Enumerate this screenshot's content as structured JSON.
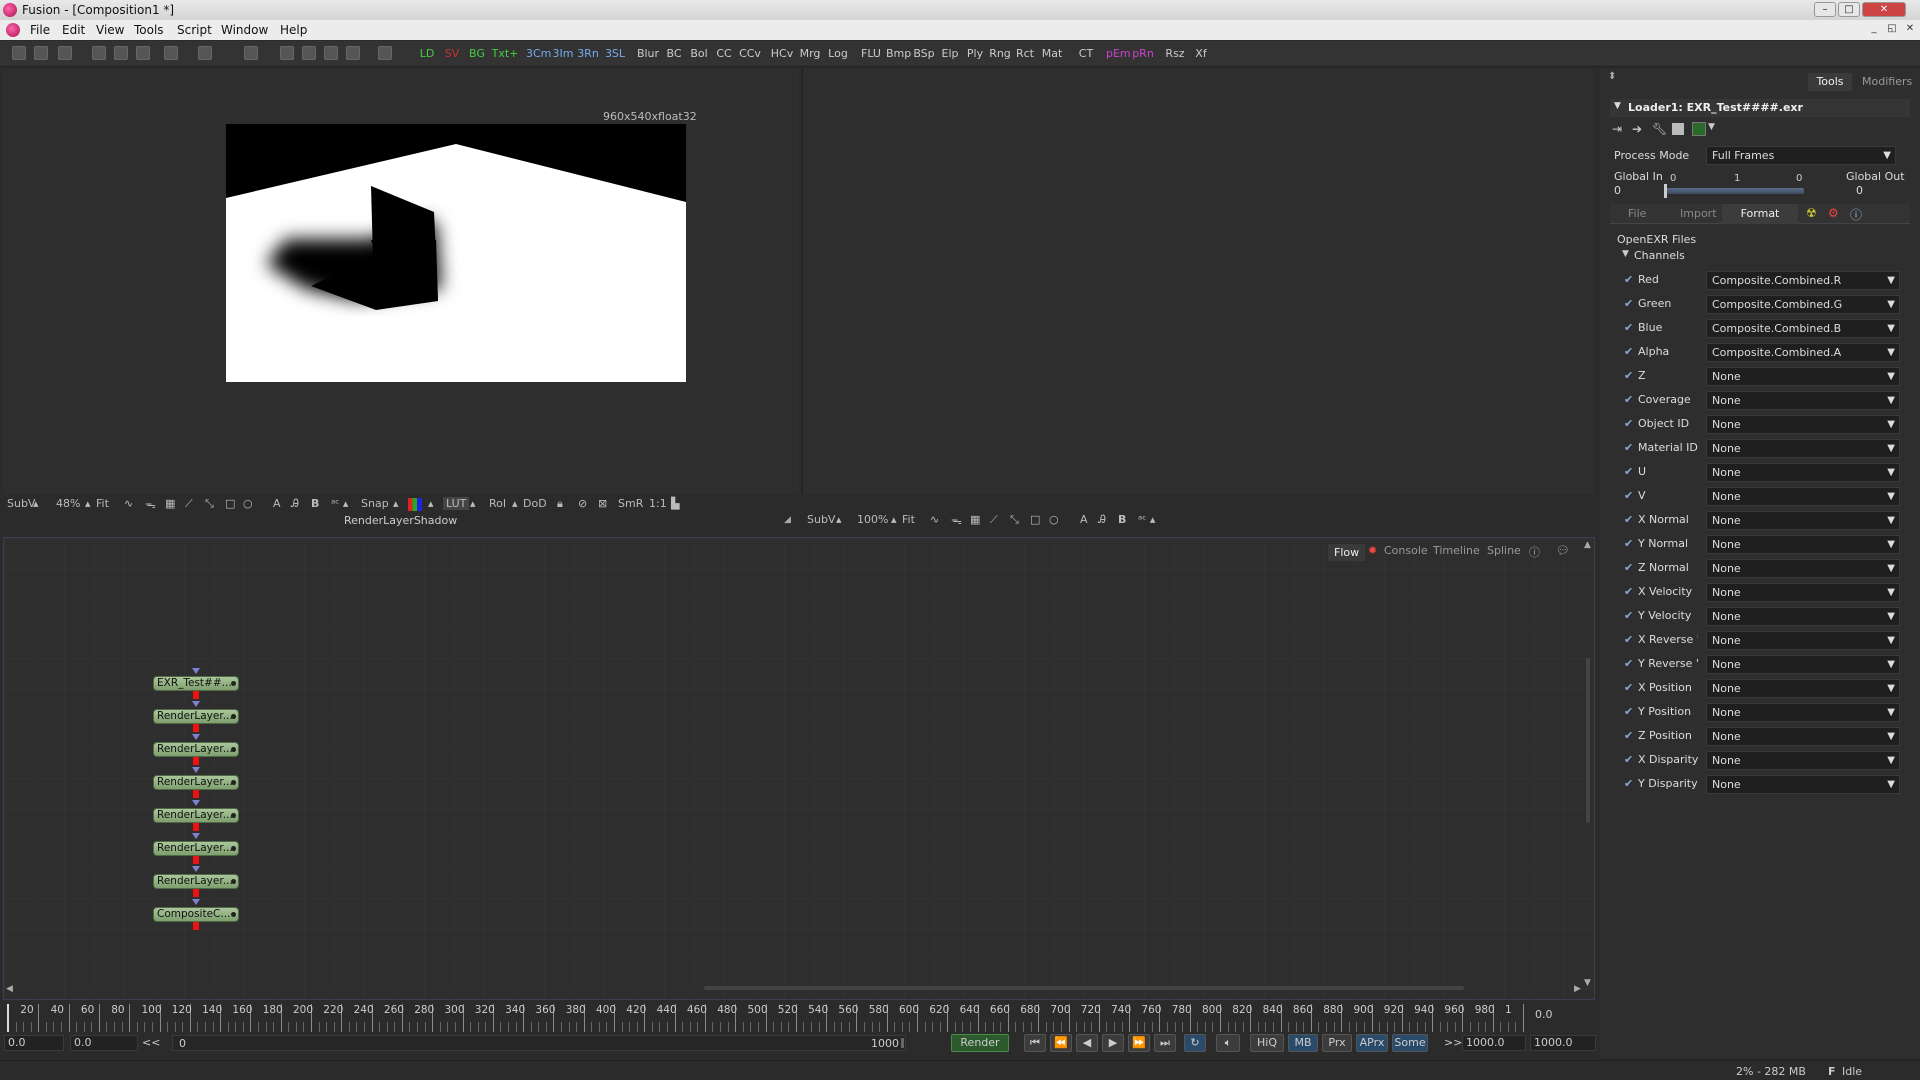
{
  "window": {
    "title": "Fusion - [Composition1 *]",
    "buttons": [
      "–",
      "□",
      "✕"
    ]
  },
  "menubar": {
    "items": [
      "File",
      "Edit",
      "View",
      "Tools",
      "Script",
      "Window",
      "Help"
    ],
    "mdi": [
      "_",
      "◱",
      "✕"
    ]
  },
  "toolbar": {
    "tools": [
      {
        "label": "LD",
        "color": "#4c4"
      },
      {
        "label": "SV",
        "color": "#c33"
      },
      {
        "label": "BG",
        "color": "#4c4"
      },
      {
        "label": "Txt+",
        "color": "#4c4"
      },
      {
        "label": "3Cm",
        "color": "#7ae"
      },
      {
        "label": "3Im",
        "color": "#7ae"
      },
      {
        "label": "3Rn",
        "color": "#7ae"
      },
      {
        "label": "3SL",
        "color": "#7ae"
      },
      {
        "label": "Blur",
        "color": "#ccc"
      },
      {
        "label": "BC",
        "color": "#ccc"
      },
      {
        "label": "Bol",
        "color": "#ccc"
      },
      {
        "label": "CC",
        "color": "#ccc"
      },
      {
        "label": "CCv",
        "color": "#ccc"
      },
      {
        "label": "HCv",
        "color": "#ccc"
      },
      {
        "label": "Mrg",
        "color": "#ccc"
      },
      {
        "label": "Log",
        "color": "#ccc"
      },
      {
        "label": "FLU",
        "color": "#ccc"
      },
      {
        "label": "Bmp",
        "color": "#ccc"
      },
      {
        "label": "BSp",
        "color": "#ccc"
      },
      {
        "label": "Elp",
        "color": "#ccc"
      },
      {
        "label": "Ply",
        "color": "#ccc"
      },
      {
        "label": "Rng",
        "color": "#ccc"
      },
      {
        "label": "Rct",
        "color": "#ccc"
      },
      {
        "label": "Mat",
        "color": "#ccc"
      },
      {
        "label": "CT",
        "color": "#ccc"
      },
      {
        "label": "pEm",
        "color": "#c4c"
      },
      {
        "label": "pRn",
        "color": "#c4c"
      },
      {
        "label": "Rsz",
        "color": "#ccc"
      },
      {
        "label": "Xf",
        "color": "#ccc"
      }
    ]
  },
  "viewer_left": {
    "resolution": "960x540xfloat32",
    "controls": [
      "SubV",
      "48%",
      "Fit",
      "Snap",
      "LUT",
      "RoI",
      "DoD",
      "SmR",
      "1:1"
    ],
    "caption": "RenderLayerShadow"
  },
  "viewer_right": {
    "controls": [
      "SubV",
      "100%",
      "Fit"
    ]
  },
  "flow": {
    "tabs": [
      "Flow",
      "Console",
      "Timeline",
      "Spline"
    ],
    "nodes": [
      "EXR_Test##...",
      "RenderLayer....",
      "RenderLayer....",
      "RenderLayer....",
      "RenderLayer....",
      "RenderLayer....",
      "RenderLayer....",
      "CompositeC..."
    ]
  },
  "timeline": {
    "ticks": [
      "20",
      "40",
      "60",
      "80",
      "100",
      "120",
      "140",
      "160",
      "180",
      "200",
      "220",
      "240",
      "260",
      "280",
      "300",
      "320",
      "340",
      "360",
      "380",
      "400",
      "420",
      "440",
      "460",
      "480",
      "500",
      "520",
      "540",
      "560",
      "580",
      "600",
      "620",
      "640",
      "660",
      "680",
      "700",
      "720",
      "740",
      "760",
      "780",
      "800",
      "820",
      "840",
      "860",
      "880",
      "900",
      "920",
      "940",
      "960",
      "980",
      "1"
    ],
    "current": "0.0",
    "start": "0.0",
    "render_start": "0.0",
    "back": "<<",
    "range_start": "0",
    "range_end": "1000",
    "render_label": "Render",
    "buttons": [
      "HiQ",
      "MB",
      "Prx",
      "APrx",
      "Some"
    ],
    "fwd": ">>",
    "render_end": "1000.0",
    "end": "1000.0"
  },
  "status": {
    "memory": "2% - 282 MB",
    "state": "Idle"
  },
  "inspector": {
    "tabs": [
      "Tools",
      "Modifiers"
    ],
    "tool_title": "Loader1: EXR_Test####.exr",
    "process_mode_label": "Process Mode",
    "process_mode_value": "Full Frames",
    "global_in_label": "Global In",
    "global_out_label": "Global Out",
    "global_in": "0",
    "global_out": "0",
    "slider_min": "0",
    "slider_mid": "1",
    "slider_max": "0",
    "subtabs": [
      "File",
      "Import",
      "Format"
    ],
    "section": "OpenEXR Files",
    "group": "Channels",
    "channels": [
      {
        "label": "Red",
        "value": "Composite.Combined.R"
      },
      {
        "label": "Green",
        "value": "Composite.Combined.G"
      },
      {
        "label": "Blue",
        "value": "Composite.Combined.B"
      },
      {
        "label": "Alpha",
        "value": "Composite.Combined.A"
      },
      {
        "label": "Z",
        "value": "None"
      },
      {
        "label": "Coverage",
        "value": "None"
      },
      {
        "label": "Object ID",
        "value": "None"
      },
      {
        "label": "Material ID",
        "value": "None"
      },
      {
        "label": "U",
        "value": "None"
      },
      {
        "label": "V",
        "value": "None"
      },
      {
        "label": "X Normal",
        "value": "None"
      },
      {
        "label": "Y Normal",
        "value": "None"
      },
      {
        "label": "Z Normal",
        "value": "None"
      },
      {
        "label": "X Velocity",
        "value": "None"
      },
      {
        "label": "Y Velocity",
        "value": "None"
      },
      {
        "label": "X Reverse '",
        "value": "None"
      },
      {
        "label": "Y Reverse '",
        "value": "None"
      },
      {
        "label": "X Position",
        "value": "None"
      },
      {
        "label": "Y Position",
        "value": "None"
      },
      {
        "label": "Z Position",
        "value": "None"
      },
      {
        "label": "X Disparity",
        "value": "None"
      },
      {
        "label": "Y Disparity",
        "value": "None"
      }
    ]
  }
}
